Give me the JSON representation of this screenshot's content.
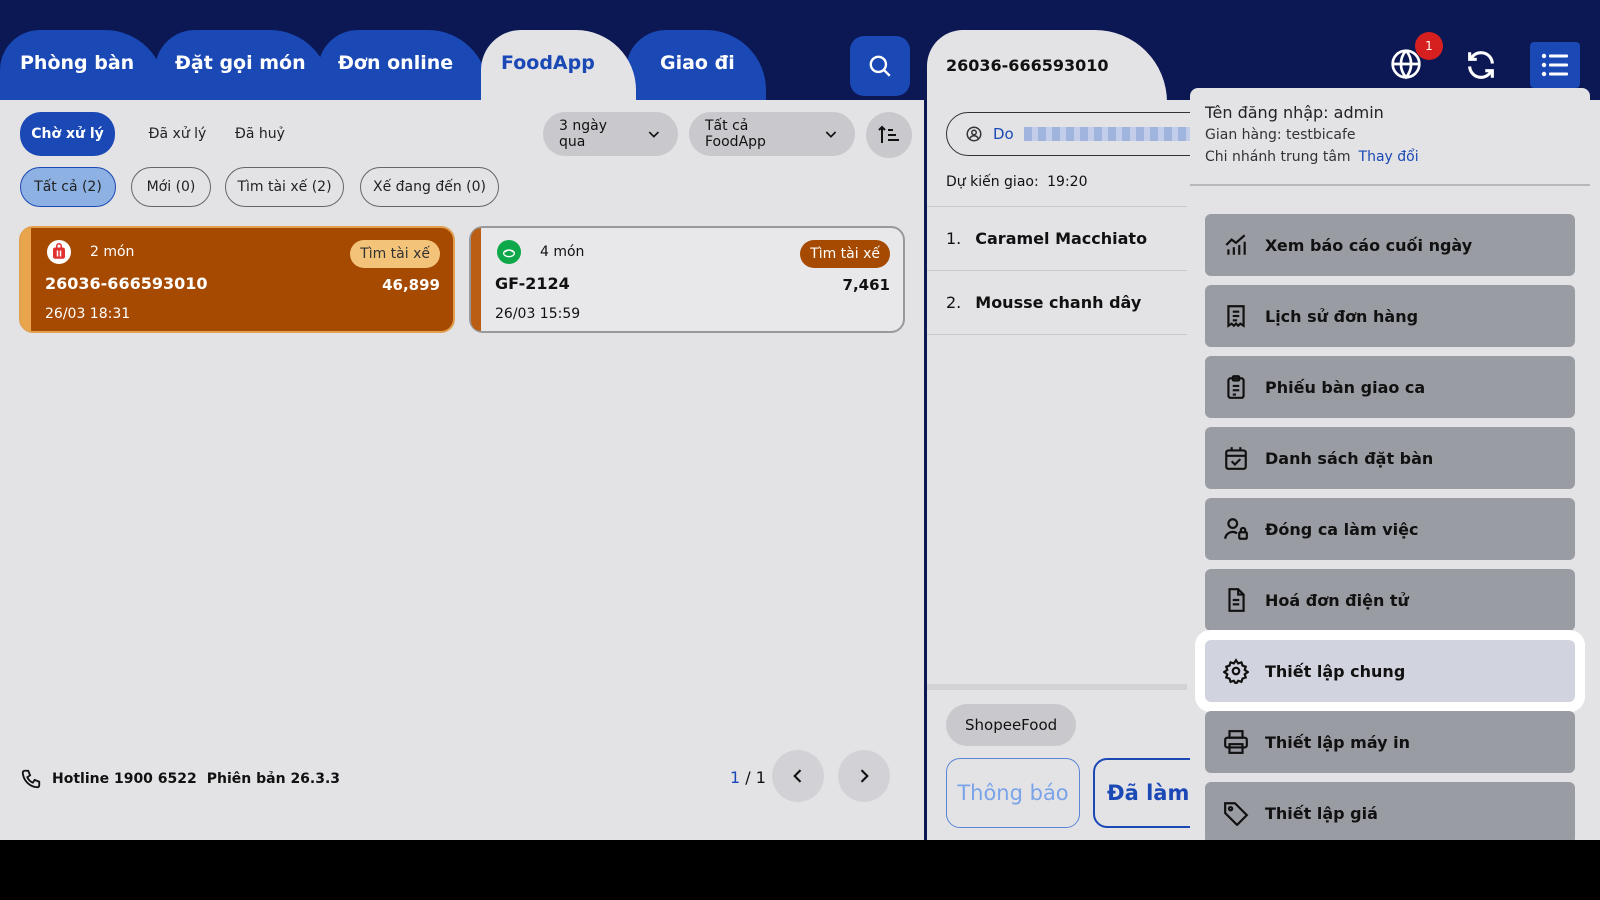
{
  "tabs": [
    {
      "label": "Phòng bàn"
    },
    {
      "label": "Đặt gọi món"
    },
    {
      "label": "Đơn online"
    },
    {
      "label": "FoodApp"
    },
    {
      "label": "Giao đi"
    }
  ],
  "status_filters": [
    "Chờ xử lý",
    "Đã xử lý",
    "Đã huỷ"
  ],
  "date_range": "3 ngày qua",
  "foodapp_filter": "Tất cả FoodApp",
  "sub_filters": [
    "Tất cả (2)",
    "Mới (0)",
    "Tìm tài xế (2)",
    "Xế đang đến (0)"
  ],
  "orders": [
    {
      "count": "2 món",
      "badge": "Tìm tài xế",
      "id": "26036-666593010",
      "total": "46,899",
      "time": "26/03 18:31"
    },
    {
      "count": "4 món",
      "badge": "Tìm tài xế",
      "id": "GF-2124",
      "total": "7,461",
      "time": "26/03 15:59"
    }
  ],
  "footer": {
    "hotline": "Hotline 1900 6522",
    "version": "Phiên bản 26.3.3"
  },
  "pager": {
    "current": "1",
    "separator": "/",
    "total": "1"
  },
  "detail": {
    "order_id": "26036-666593010",
    "customer_prefix": "Do",
    "eta_label": "Dự kiến giao:",
    "eta_time": "19:20",
    "items": [
      {
        "num": "1.",
        "name": "Caramel Macchiato"
      },
      {
        "num": "2.",
        "name": "Mousse chanh dây"
      }
    ],
    "source": "ShopeeFood",
    "notify_label": "Thông báo",
    "done_label": "Đã làm x"
  },
  "notification_count": "1",
  "menu": {
    "username_label": "Tên đăng nhập: admin",
    "shop_label": "Gian hàng: testbicafe",
    "branch_label": "Chi nhánh trung tâm",
    "change_label": "Thay đổi",
    "items": [
      {
        "label": "Xem báo cáo cuối ngày",
        "icon": "report-chart-icon"
      },
      {
        "label": "Lịch sử đơn hàng",
        "icon": "receipt-icon"
      },
      {
        "label": "Phiếu bàn giao ca",
        "icon": "clipboard-icon"
      },
      {
        "label": "Danh sách đặt bàn",
        "icon": "calendar-check-icon"
      },
      {
        "label": "Đóng ca làm việc",
        "icon": "user-lock-icon"
      },
      {
        "label": "Hoá đơn điện tử",
        "icon": "document-icon"
      },
      {
        "label": "Thiết lập chung",
        "icon": "gear-icon"
      },
      {
        "label": "Thiết lập máy in",
        "icon": "printer-icon"
      },
      {
        "label": "Thiết lập giá",
        "icon": "tag-icon"
      }
    ]
  },
  "colors": {
    "navy": "#0b1853",
    "primary": "#1a48b5",
    "panel": "#e3e3e6",
    "orange": "#a54a00"
  }
}
